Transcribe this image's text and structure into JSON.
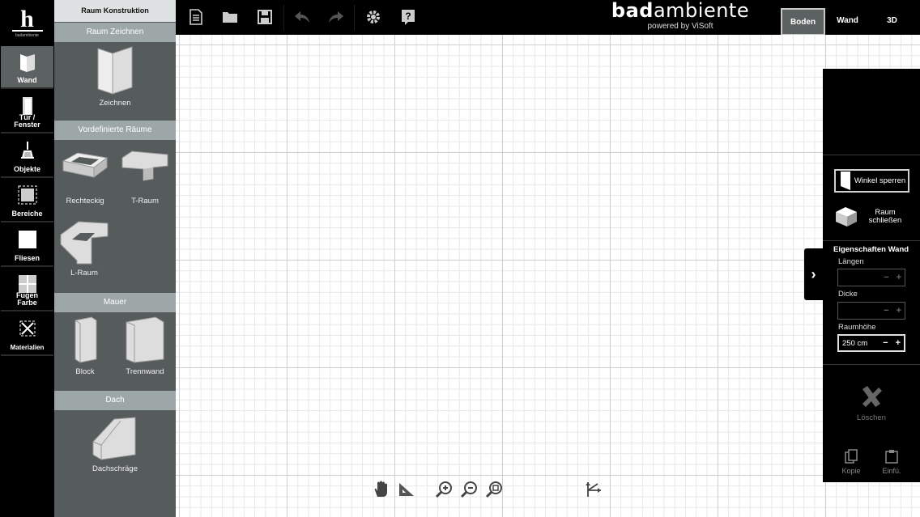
{
  "rail": {
    "logo_letter": "h",
    "logo_sub": "badambiente",
    "items": [
      {
        "label": "Wand",
        "icon": "wall-icon",
        "active": true
      },
      {
        "label": "Tür / Fenster",
        "icon": "door-icon",
        "active": false
      },
      {
        "label": "Objekte",
        "icon": "objects-icon",
        "active": false
      },
      {
        "label": "Bereiche",
        "icon": "areas-icon",
        "active": false
      },
      {
        "label": "Fliesen",
        "icon": "tiles-icon",
        "active": false
      },
      {
        "label": "Fugen Farbe",
        "icon": "grout-icon",
        "active": false
      },
      {
        "label": "Materialien",
        "icon": "materials-icon",
        "active": false
      }
    ]
  },
  "panel": {
    "title": "Raum Konstruktion",
    "sections": [
      {
        "title": "Raum Zeichnen",
        "tools": [
          {
            "label": "Zeichnen"
          }
        ]
      },
      {
        "title": "Vordefinierte Räume",
        "tools": [
          {
            "label": "Rechteckig"
          },
          {
            "label": "T-Raum"
          },
          {
            "label": "L-Raum"
          }
        ]
      },
      {
        "title": "Mauer",
        "tools": [
          {
            "label": "Block"
          },
          {
            "label": "Trennwand"
          }
        ]
      },
      {
        "title": "Dach",
        "tools": [
          {
            "label": "Dachschräge"
          }
        ]
      }
    ]
  },
  "topbar": {
    "icons": [
      "new-document-icon",
      "open-folder-icon",
      "save-icon",
      "undo-icon",
      "redo-icon",
      "settings-icon",
      "help-icon"
    ],
    "brand_bold": "bad",
    "brand_rest": "ambiente",
    "brand_sub": "powered by ViSoft",
    "views": [
      {
        "label": "Boden",
        "active": true
      },
      {
        "label": "Wand",
        "active": false
      },
      {
        "label": "3D",
        "active": false
      }
    ]
  },
  "right": {
    "winkel_label": "Winkel sperren",
    "raum_label": "Raum schließen",
    "props_title": "Eigenschaften Wand",
    "laengen_label": "Längen",
    "dicke_label": "Dicke",
    "hoehe_label": "Raumhöhe",
    "hoehe_value": "250 cm",
    "delete_label": "Löschen",
    "copy_label": "Kopie",
    "paste_label": "Einfü."
  },
  "bottom_tools": [
    "pan-hand-icon",
    "ruler-icon",
    "zoom-in-icon",
    "zoom-out-icon",
    "zoom-fit-icon",
    "axis-icon"
  ],
  "colors": {
    "accent_gray": "#5c6162",
    "panel": "#565b5c",
    "section_header": "#9ea7a7"
  }
}
